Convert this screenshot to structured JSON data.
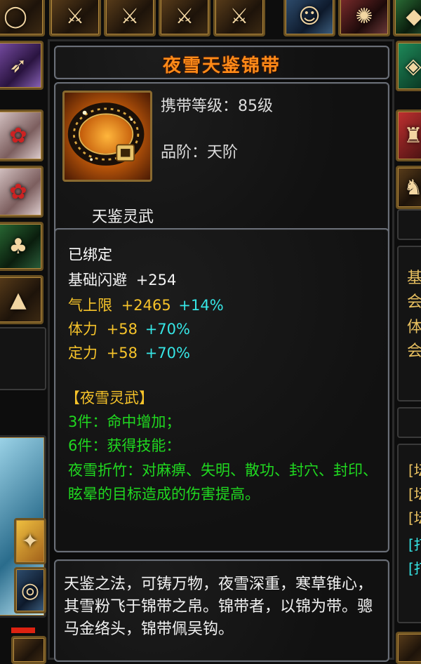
{
  "tooltip": {
    "title": "夜雪天鉴锦带",
    "icon": "belt-icon",
    "carry_level": "携带等级：85级",
    "grade": "品阶：天阶",
    "series": "天鉴灵武",
    "bound": "已绑定",
    "attributes": [
      {
        "label": "基础闪避",
        "value": "+254",
        "bonus": ""
      },
      {
        "label": "气上限",
        "value": "+2465",
        "bonus": "+14%"
      },
      {
        "label": "体力",
        "value": "+58",
        "bonus": "+70%"
      },
      {
        "label": "定力",
        "value": "+58",
        "bonus": "+70%"
      }
    ],
    "set_title": "【夜雪灵武】",
    "set_bonus_3": "3件：命中增加；",
    "set_bonus_6": "6件：获得技能：",
    "skill_desc": "夜雪折竹：对麻痹、失明、散功、封穴、封印、眩晕的目标造成的伤害提高。",
    "flavor_text": "天鉴之法，可铸万物，夜雪深重，寒草锥心，其雪粉飞于锦带之帛。锦带者，以锦为带。骢马金络头，锦带佩吴钩。"
  },
  "background": {
    "right_panel_chars": [
      "基",
      "会",
      "体",
      "会"
    ],
    "right_set_chars": [
      "[坛",
      "[坛",
      "[坛",
      "[打",
      "[打"
    ]
  },
  "colors": {
    "title": "#ff8a18",
    "gold": "#f6c32a",
    "cyan": "#36e6e6",
    "green": "#20d820"
  }
}
